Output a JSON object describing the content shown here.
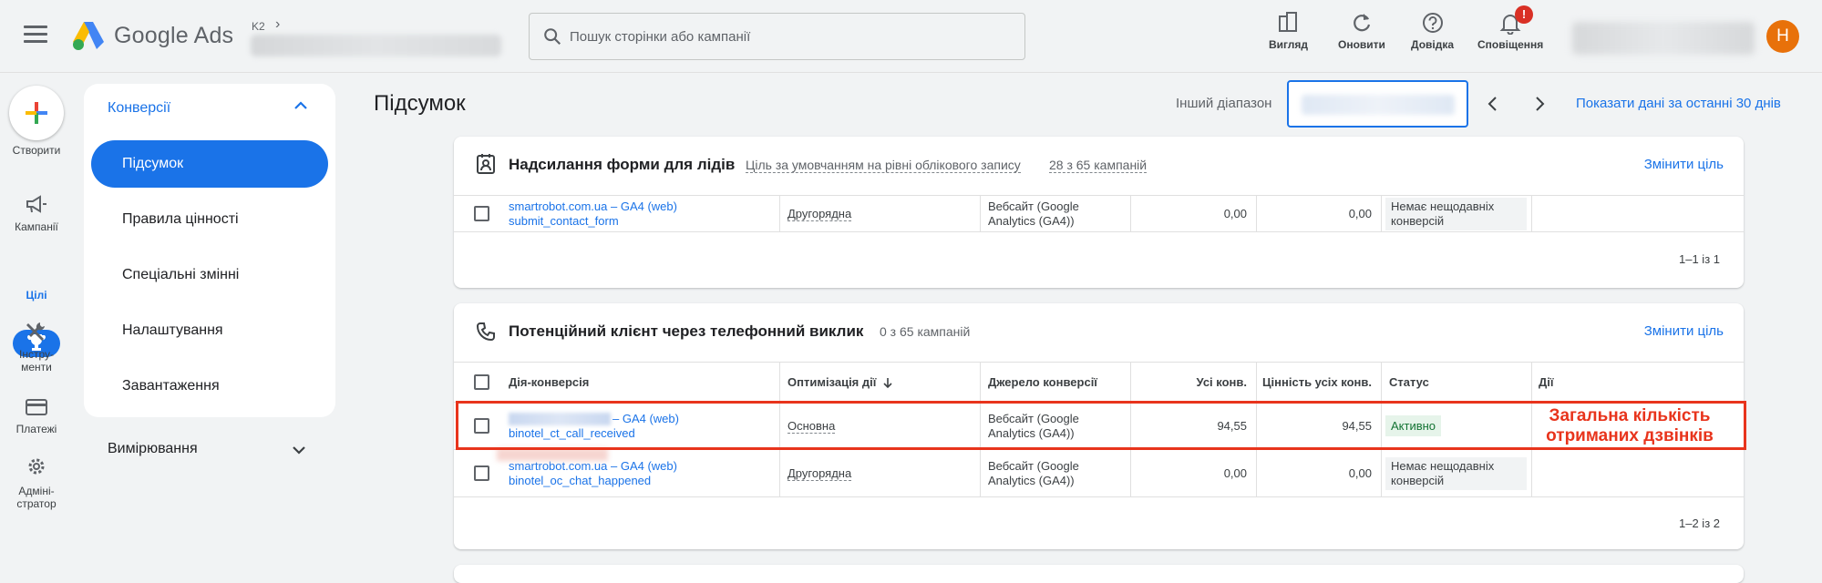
{
  "header": {
    "app_name": "Google Ads",
    "account_tag": "K2",
    "search_placeholder": "Пошук сторінки або кампанії",
    "tools": [
      {
        "label": "Вигляд",
        "icon": "view-icon"
      },
      {
        "label": "Оновити",
        "icon": "refresh-icon"
      },
      {
        "label": "Довідка",
        "icon": "help-icon"
      },
      {
        "label": "Сповіщення",
        "icon": "bell-icon"
      }
    ],
    "notification_badge": "!",
    "avatar_letter": "H",
    "avatar_color": "#e8710a"
  },
  "leftnav": {
    "create": "Створити",
    "campaigns": "Кампанії",
    "goals": "Цілі",
    "tools_line1": "Інстру-",
    "tools_line2": "менти",
    "billing": "Платежі",
    "admin_line1": "Адміні-",
    "admin_line2": "стратор"
  },
  "subnav": {
    "heading": "Конверсії",
    "items": [
      "Підсумок",
      "Правила цінності",
      "Спеціальні змінні",
      "Налаштування",
      "Завантаження"
    ],
    "measurement": "Вимірювання"
  },
  "toolbar": {
    "page_title": "Підсумок",
    "range_label": "Інший діапазон",
    "last30": "Показати дані за останні 30 днів"
  },
  "card1": {
    "title": "Надсилання форми для лідів",
    "sub1": "Ціль за умовчанням на рівні облікового запису",
    "sub2": "28 з 65 кампаній",
    "action": "Змінити ціль",
    "row": {
      "name_line1": "smartrobot.com.ua – GA4 (web)",
      "name_line2": "submit_contact_form",
      "optimization": "Другорядна",
      "source": "Вебсайт (Google Analytics (GA4))",
      "all_conv": "0,00",
      "all_value": "0,00",
      "status": "Немає нещодавніх конверсій"
    },
    "pager": "1–1 із 1"
  },
  "card2": {
    "title": "Потенційний клієнт через телефонний виклик",
    "sub1": "0 з 65 кампаній",
    "action": "Змінити ціль",
    "headers": {
      "action": "Дія-конверсія",
      "optimization": "Оптимізація дії",
      "source": "Джерело конверсії",
      "all_conv": "Усі конв.",
      "all_value": "Цінність усіх конв.",
      "status": "Статус",
      "actions": "Дії"
    },
    "rows": [
      {
        "name_line1": "– GA4 (web)",
        "name_line2": "binotel_ct_call_received",
        "optimization": "Основна",
        "source": "Вебсайт (Google Analytics (GA4))",
        "all_conv": "94,55",
        "all_value": "94,55",
        "status": "Активно"
      },
      {
        "name_line1": "smartrobot.com.ua – GA4 (web)",
        "name_line2": "binotel_oc_chat_happened",
        "optimization": "Другорядна",
        "source": "Вебсайт (Google Analytics (GA4))",
        "all_conv": "0,00",
        "all_value": "0,00",
        "status": "Немає нещодавніх конверсій"
      }
    ],
    "pager": "1–2 із 2"
  },
  "annotation": {
    "line1": "Загальна кількість",
    "line2": "отриманих дзвінків",
    "color": "#e8341c"
  }
}
